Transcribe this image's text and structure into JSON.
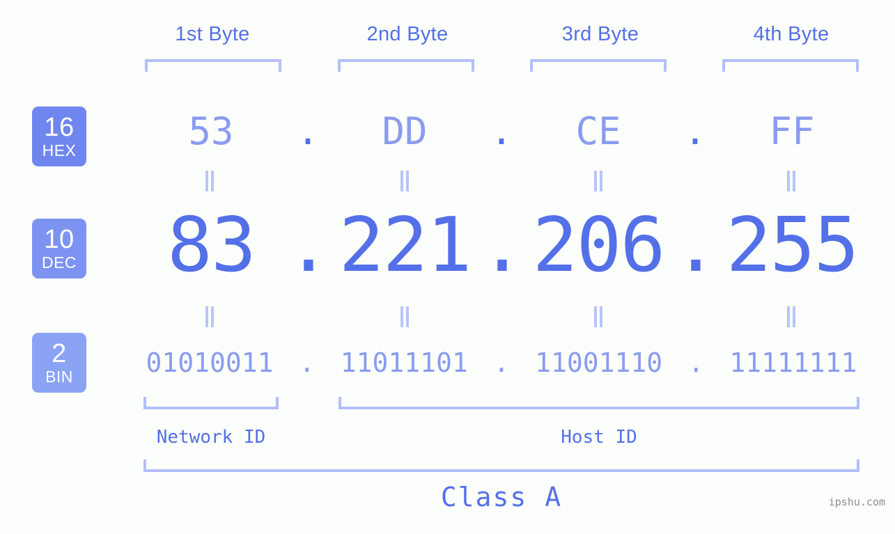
{
  "background_color": "#fcfefb",
  "colors": {
    "accent_strong": "#5470e8",
    "accent_light": "#8a9bf0",
    "bracket": "#b3bffa",
    "badge_hex": "#6f86ef",
    "badge_dec": "#7d93f2",
    "badge_bin": "#8aa3f5",
    "watermark": "#8d8d8d"
  },
  "byte_headers": [
    {
      "label": "1st Byte"
    },
    {
      "label": "2nd Byte"
    },
    {
      "label": "3rd Byte"
    },
    {
      "label": "4th Byte"
    }
  ],
  "radix_badges": [
    {
      "number": "16",
      "base": "HEX"
    },
    {
      "number": "10",
      "base": "DEC"
    },
    {
      "number": "2",
      "base": "BIN"
    }
  ],
  "rows": {
    "hex": {
      "octets": [
        "53",
        "DD",
        "CE",
        "FF"
      ],
      "separator": "."
    },
    "dec": {
      "octets": [
        "83",
        "221",
        "206",
        "255"
      ],
      "separator": "."
    },
    "bin": {
      "octets": [
        "01010011",
        "11011101",
        "11001110",
        "11111111"
      ],
      "separator": "."
    }
  },
  "equality_marks": {
    "glyph": "=",
    "count_per_row": 4,
    "rows": 2
  },
  "sections": [
    {
      "label": "Network ID"
    },
    {
      "label": "Host ID"
    }
  ],
  "class": {
    "label": "Class A"
  },
  "watermark": {
    "text": "ipshu.com"
  },
  "ip_address": {
    "hex": "53.DD.CE.FF",
    "decimal": "83.221.206.255",
    "binary": "01010011.11011101.11001110.11111111",
    "class": "Class A",
    "network_id_bytes": 1,
    "host_id_bytes": 3
  }
}
